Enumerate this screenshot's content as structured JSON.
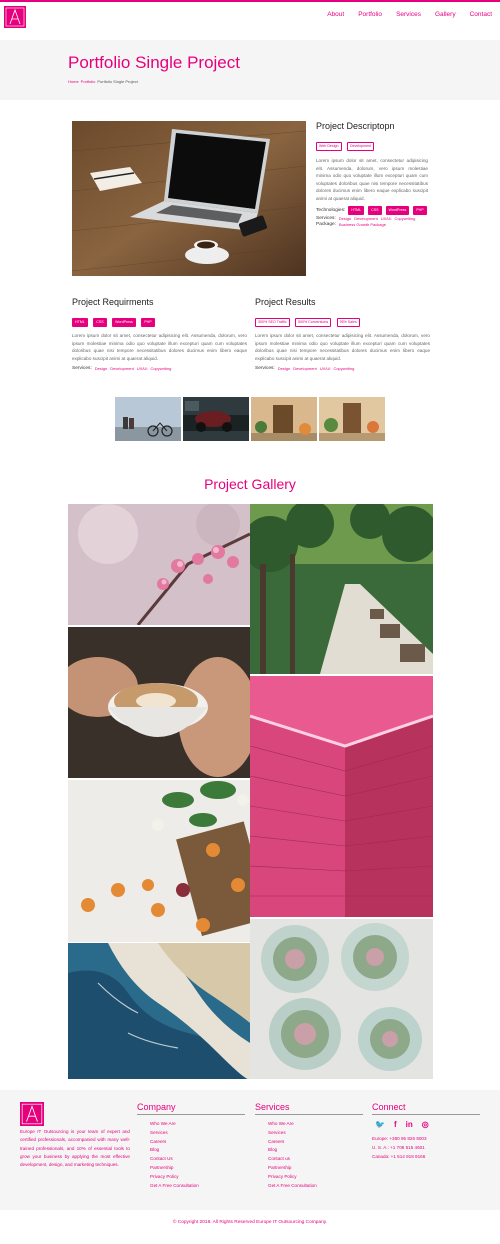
{
  "brand": {
    "accent": "#e6007e",
    "logo_letter": "A"
  },
  "nav": {
    "items": [
      "About",
      "Portfolio",
      "Services",
      "Gallery",
      "Contact"
    ]
  },
  "hero": {
    "title": "Portfolio Single Project",
    "breadcrumb": [
      "Home",
      "Portfolio",
      "Portfolio Single Project"
    ]
  },
  "project": {
    "desc_title": "Project Descriptopn",
    "categories": [
      "Web Design",
      "Development"
    ],
    "desc_text": "Lorem ipsum dolor sit amet, consectetur adipisicing elit. Assumenda, dolorum, vero ipsum molestiae minima odio quo voluptate illum excepturi quam cum voluptates doloribus quae nisi tempore necessitatibus dolores ducimus enim libero eaque explicabo suscipit animi at quaerat aliquid.",
    "technologies_label": "Technologies:",
    "technologies": [
      "HTML",
      "CSS",
      "WordPress",
      "PHP"
    ],
    "services_label": "Services:",
    "services": [
      "Design",
      "Development",
      "UX/UI",
      "Copywriting"
    ],
    "package_label": "Package:",
    "package": "Business Growth Package"
  },
  "requirements": {
    "title": "Project Requirments",
    "tags": [
      "HTML",
      "CSS",
      "WordPress",
      "PHP"
    ],
    "text": "Lorem ipsum dolor sit amet, consectetur adipisicing elit. Assumenda, dolorum, vero ipsum molestiae minima odio quo voluptate illum excepturi quam cum voluptates doloribus quae nisi tempore necessitatibus dolores ducimus enim libero eaque explicabo suscipit animi at quaerat aliquid.",
    "services_label": "Services:",
    "services": [
      "Design",
      "Development",
      "UX/UI",
      "Copywriting"
    ]
  },
  "results": {
    "title": "Project Results",
    "tags": [
      "300% SEO Traffic",
      "500% Conversions",
      "95% Sales"
    ],
    "text": "Lorem ipsum dolor sit amet, consectetur adipisicing elit. Assumenda, dolorum, vero ipsum molestiae minima odio quo voluptate illum excepturi quam cum voluptates doloribus quae nisi tempore necessitatibus dolores ducimus enim libero eaque explicabo suscipit animi at quaerat aliquid.",
    "services_label": "Services:",
    "services": [
      "Design",
      "Development",
      "UX/UI",
      "Copywriting"
    ]
  },
  "gallery": {
    "title": "Project Gallery"
  },
  "footer": {
    "about": "Europe IT Outsourcing is your team of expert and certified professionals, accompanied with many well-trained professionals, and 10% of essential tools to grow your business by applying the most effective development, design, and marketing techniques.",
    "company_title": "Company",
    "company_links": [
      "Who We Are",
      "Services",
      "Careers",
      "Blog",
      "Contact Us",
      "Partnership",
      "Privacy Policy",
      "Get A Free Consultation"
    ],
    "services_title": "Services",
    "services_links": [
      "Who We Are",
      "Services",
      "Careers",
      "Blog",
      "Contact us",
      "Partnership",
      "Privacy Policy",
      "Get A Free Consultation"
    ],
    "connect_title": "Connect",
    "social": [
      "twitter-icon",
      "facebook-icon",
      "linkedin-icon",
      "instagram-icon"
    ],
    "phones": [
      "Europe: +380 95 826 5003",
      "U. S. A.: +1 708 515 4601",
      "Canada: +1 514 918 9166"
    ],
    "copyright": "© Copyright 2018. All Rights Reserved Europe IT Outsourcing Company."
  }
}
